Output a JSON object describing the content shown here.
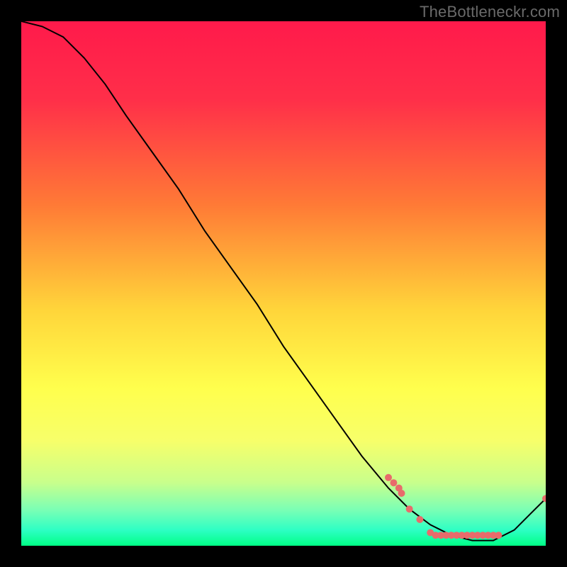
{
  "watermark": "TheBottleneckr.com",
  "chart_data": {
    "type": "line",
    "title": "",
    "xlabel": "",
    "ylabel": "",
    "xlim": [
      0,
      100
    ],
    "ylim": [
      0,
      100
    ],
    "gradient_stops": [
      {
        "offset": 0.0,
        "color": "#ff1a4b"
      },
      {
        "offset": 0.15,
        "color": "#ff2f49"
      },
      {
        "offset": 0.35,
        "color": "#ff7a36"
      },
      {
        "offset": 0.55,
        "color": "#ffd53a"
      },
      {
        "offset": 0.7,
        "color": "#ffff4d"
      },
      {
        "offset": 0.8,
        "color": "#f7ff6a"
      },
      {
        "offset": 0.88,
        "color": "#c8ff8c"
      },
      {
        "offset": 0.93,
        "color": "#7dffb4"
      },
      {
        "offset": 0.97,
        "color": "#2effc4"
      },
      {
        "offset": 1.0,
        "color": "#00ff86"
      }
    ],
    "series": [
      {
        "name": "curve",
        "stroke": "#000000",
        "stroke_width": 2,
        "points": [
          {
            "x": 0,
            "y": 100
          },
          {
            "x": 4,
            "y": 99
          },
          {
            "x": 8,
            "y": 97
          },
          {
            "x": 12,
            "y": 93
          },
          {
            "x": 16,
            "y": 88
          },
          {
            "x": 20,
            "y": 82
          },
          {
            "x": 25,
            "y": 75
          },
          {
            "x": 30,
            "y": 68
          },
          {
            "x": 35,
            "y": 60
          },
          {
            "x": 40,
            "y": 53
          },
          {
            "x": 45,
            "y": 46
          },
          {
            "x": 50,
            "y": 38
          },
          {
            "x": 55,
            "y": 31
          },
          {
            "x": 60,
            "y": 24
          },
          {
            "x": 65,
            "y": 17
          },
          {
            "x": 70,
            "y": 11
          },
          {
            "x": 74,
            "y": 7
          },
          {
            "x": 78,
            "y": 4
          },
          {
            "x": 82,
            "y": 2
          },
          {
            "x": 86,
            "y": 1
          },
          {
            "x": 90,
            "y": 1
          },
          {
            "x": 94,
            "y": 3
          },
          {
            "x": 97,
            "y": 6
          },
          {
            "x": 100,
            "y": 9
          }
        ]
      }
    ],
    "markers": {
      "color": "#e86b6b",
      "radius": 5,
      "points": [
        {
          "x": 70,
          "y": 13
        },
        {
          "x": 71,
          "y": 12
        },
        {
          "x": 72,
          "y": 11
        },
        {
          "x": 72.5,
          "y": 10
        },
        {
          "x": 74,
          "y": 7
        },
        {
          "x": 76,
          "y": 5
        },
        {
          "x": 78,
          "y": 2.5
        },
        {
          "x": 79,
          "y": 2
        },
        {
          "x": 80,
          "y": 2
        },
        {
          "x": 81,
          "y": 2
        },
        {
          "x": 82,
          "y": 2
        },
        {
          "x": 83,
          "y": 2
        },
        {
          "x": 84,
          "y": 2
        },
        {
          "x": 85,
          "y": 2
        },
        {
          "x": 86,
          "y": 2
        },
        {
          "x": 87,
          "y": 2
        },
        {
          "x": 88,
          "y": 2
        },
        {
          "x": 89,
          "y": 2
        },
        {
          "x": 90,
          "y": 2
        },
        {
          "x": 91,
          "y": 2
        },
        {
          "x": 100,
          "y": 9
        }
      ]
    }
  }
}
